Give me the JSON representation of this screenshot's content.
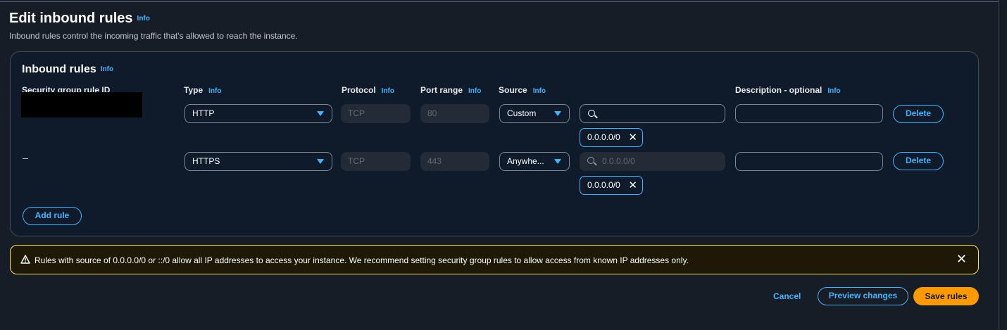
{
  "page": {
    "title": "Edit inbound rules",
    "title_info": "Info",
    "subtitle": "Inbound rules control the incoming traffic that's allowed to reach the instance."
  },
  "panel": {
    "title": "Inbound rules",
    "info": "Info",
    "columns": {
      "rule_id": "Security group rule ID",
      "type": "Type",
      "type_info": "Info",
      "protocol": "Protocol",
      "protocol_info": "Info",
      "port_range": "Port range",
      "port_info": "Info",
      "source": "Source",
      "source_info": "Info",
      "description": "Description - optional",
      "description_info": "Info"
    },
    "rules": [
      {
        "rule_id": "",
        "type": "HTTP",
        "protocol": "TCP",
        "port_range": "80",
        "source_type": "Custom",
        "source_search": "",
        "source_placeholder": "",
        "cidr_token": "0.0.0.0/0",
        "description": "",
        "delete_label": "Delete"
      },
      {
        "rule_id": "–",
        "type": "HTTPS",
        "protocol": "TCP",
        "port_range": "443",
        "source_type": "Anywhe...",
        "source_search": "",
        "source_placeholder": "0.0.0.0/0",
        "cidr_token": "0.0.0.0/0",
        "description": "",
        "delete_label": "Delete"
      }
    ],
    "add_rule_label": "Add rule"
  },
  "warning": {
    "text": "Rules with source of 0.0.0.0/0 or ::/0 allow all IP addresses to access your instance. We recommend setting security group rules to allow access from known IP addresses only.",
    "color": "#ffe347"
  },
  "footer": {
    "cancel_label": "Cancel",
    "preview_label": "Preview changes",
    "save_label": "Save rules"
  },
  "colors": {
    "background": "#161d26",
    "accent": "#42b4ff",
    "primary_button": "#ff9900"
  },
  "icons": {
    "search": "search-icon",
    "remove_token": "close-icon",
    "dropdown": "caret-down-icon",
    "warning": "warning-icon",
    "dismiss": "close-icon"
  }
}
